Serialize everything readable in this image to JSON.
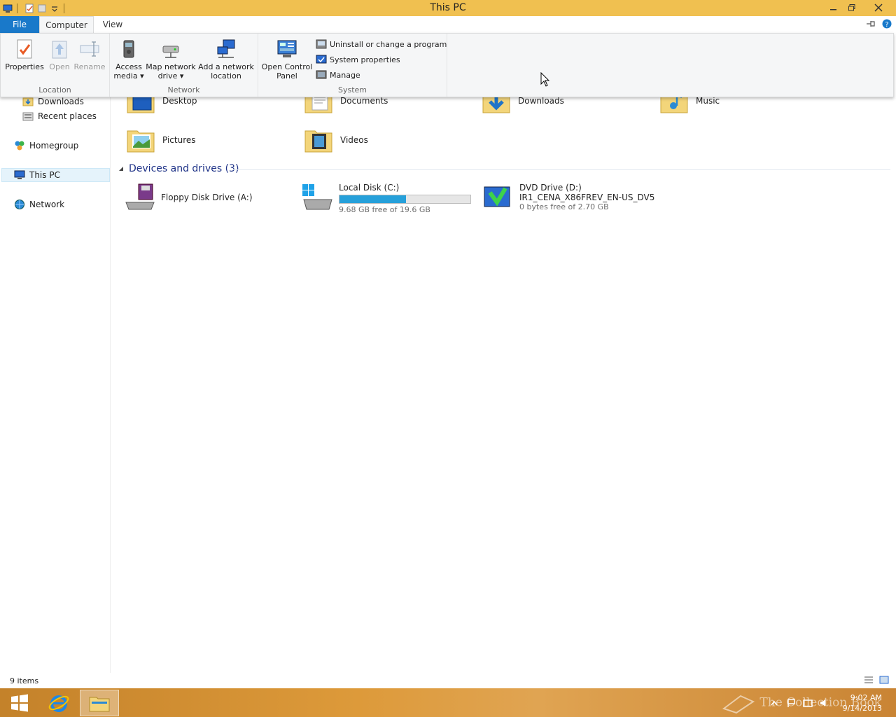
{
  "window": {
    "title": "This PC"
  },
  "ribbon": {
    "tabs": {
      "file": "File",
      "computer": "Computer",
      "view": "View"
    },
    "groups": {
      "location": {
        "label": "Location",
        "properties": "Properties",
        "open": "Open",
        "rename": "Rename"
      },
      "network": {
        "label": "Network",
        "access_media_1": "Access",
        "access_media_2": "media",
        "map_drive_1": "Map network",
        "map_drive_2": "drive",
        "add_location_1": "Add a network",
        "add_location_2": "location"
      },
      "system": {
        "label": "System",
        "control_panel_1": "Open Control",
        "control_panel_2": "Panel",
        "uninstall": "Uninstall or change a program",
        "system_properties": "System properties",
        "manage": "Manage"
      }
    }
  },
  "nav": {
    "downloads": "Downloads",
    "recent": "Recent places",
    "homegroup": "Homegroup",
    "thispc": "This PC",
    "network": "Network"
  },
  "folders": {
    "desktop": "Desktop",
    "documents": "Documents",
    "downloads": "Downloads",
    "music": "Music",
    "pictures": "Pictures",
    "videos": "Videos"
  },
  "devices": {
    "header": "Devices and drives (3)",
    "floppy": "Floppy Disk Drive (A:)",
    "local_disk": {
      "name": "Local Disk (C:)",
      "free": "9.68 GB free of 19.6 GB",
      "used_fraction": 0.506
    },
    "dvd": {
      "name": "DVD Drive (D:)",
      "label": "IR1_CENA_X86FREV_EN-US_DV5",
      "free": "0 bytes free of 2.70 GB"
    }
  },
  "status": {
    "items": "9 items"
  },
  "taskbar": {
    "time": "9:02 AM",
    "date": "9/14/2013",
    "watermark": "The Collection Book"
  },
  "colors": {
    "accent": "#1979ca",
    "title_bar": "#f0c050",
    "progress": "#26a0da"
  }
}
